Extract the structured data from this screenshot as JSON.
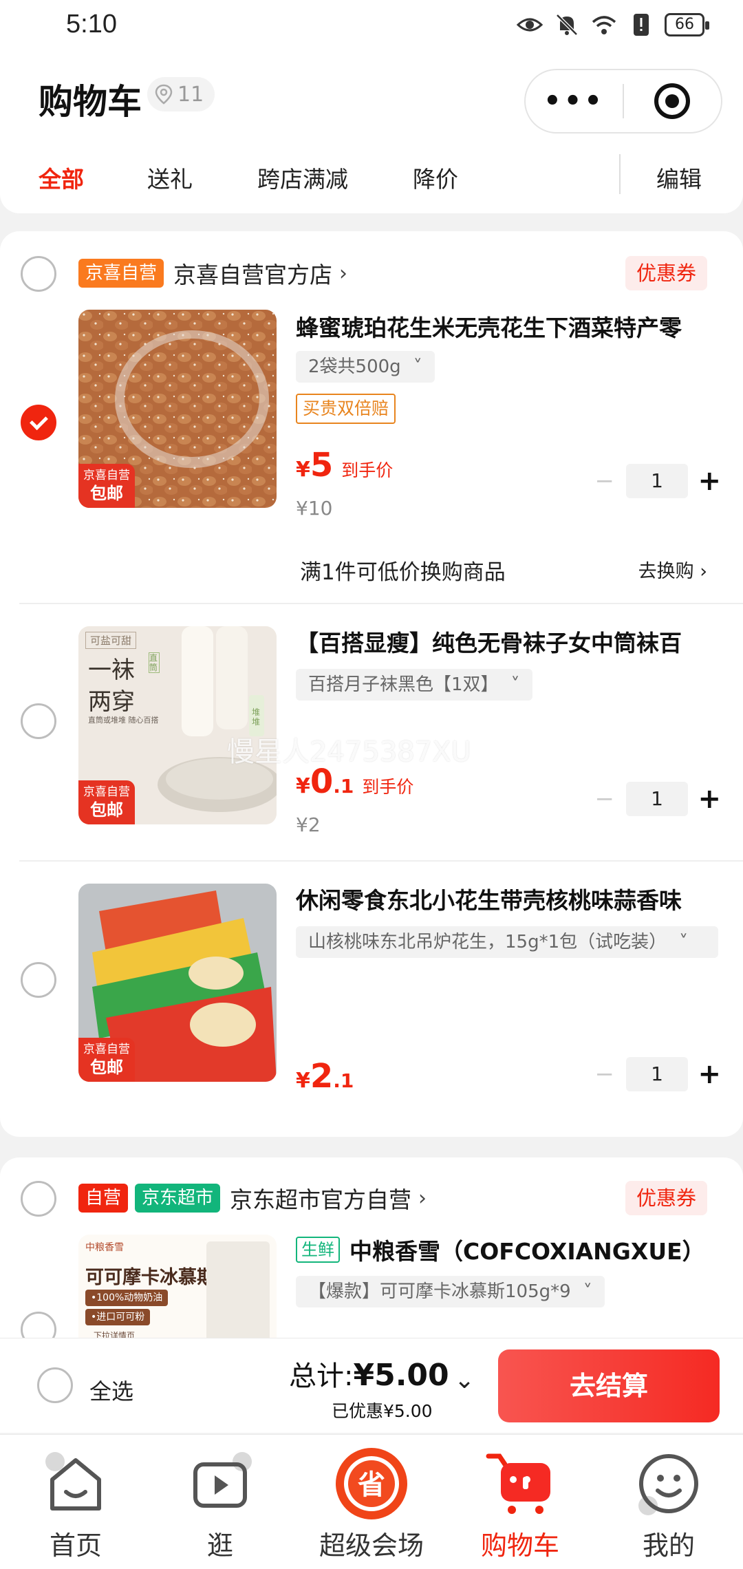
{
  "status_bar": {
    "time": "5:10",
    "battery": "66"
  },
  "header": {
    "title": "购物车",
    "location_count": "11",
    "capsule_more": "•••",
    "tabs": [
      "全部",
      "送礼",
      "跨店满减",
      "降价"
    ],
    "edit_label": "编辑"
  },
  "shops": [
    {
      "badges": [
        "京喜自营"
      ],
      "name": "京喜自营官方店",
      "coupon": "优惠券",
      "items": [
        {
          "name": "蜂蜜琥珀花生米无壳花生下酒菜特产零",
          "spec": "2袋共500g",
          "guarantee": "买贵双倍赔",
          "price_int": "5",
          "price_dec": "",
          "price_note": "到手价",
          "original_price": "¥10",
          "quantity": "1",
          "checked": true,
          "tag_top": "京喜自营",
          "tag_bottom": "包邮",
          "swap_text": "满1件可低价换购商品",
          "swap_link": "去换购"
        },
        {
          "name": "【百搭显瘦】纯色无骨袜子女中筒袜百",
          "spec": "百搭月子袜黑色【1双】",
          "price_int": "0",
          "price_dec": ".1",
          "price_note": "到手价",
          "original_price": "¥2",
          "quantity": "1",
          "checked": false,
          "tag_top": "京喜自营",
          "tag_bottom": "包邮",
          "img_text_1": "可盐可甜",
          "img_text_2": "一袜",
          "img_text_3": "两穿",
          "img_text_4": "直筒或堆堆 随心百搭",
          "img_text_5": "直筒",
          "img_text_6": "堆堆"
        },
        {
          "name": "休闲零食东北小花生带壳核桃味蒜香味",
          "spec": "山核桃味东北吊炉花生，15g*1包（试吃装）",
          "price_int": "2",
          "price_dec": ".1",
          "quantity": "1",
          "checked": false,
          "tag_top": "京喜自营",
          "tag_bottom": "包邮"
        }
      ]
    },
    {
      "badges": [
        "自营",
        "京东超市"
      ],
      "name": "京东超市官方自营",
      "coupon": "优惠券",
      "items": [
        {
          "fresh_tag": "生鲜",
          "name": "中粮香雪（COFCOXIANGXUE）",
          "spec": "【爆款】可可摩卡冰慕斯105g*9",
          "img_brand": "中粮香雪",
          "img_title": "可可摩卡冰慕斯",
          "img_line1": "•100%动物奶油",
          "img_line2": "•进口可可粉",
          "img_line3": "下拉详情页",
          "checked": false
        }
      ]
    }
  ],
  "watermark": "慢星人2475387XU",
  "checkout": {
    "select_all": "全选",
    "total_label": "总计:",
    "total_value": "¥5.00",
    "saved": "已优惠¥5.00",
    "pay_button": "去结算"
  },
  "nav": {
    "items": [
      "首页",
      "逛",
      "超级会场",
      "购物车",
      "我的"
    ],
    "super_icon_text": "省",
    "active": "购物车"
  },
  "colors": {
    "accent": "#f0250f",
    "jingxi_orange": "#fa7a1f",
    "supermarket_green": "#12b57b"
  }
}
